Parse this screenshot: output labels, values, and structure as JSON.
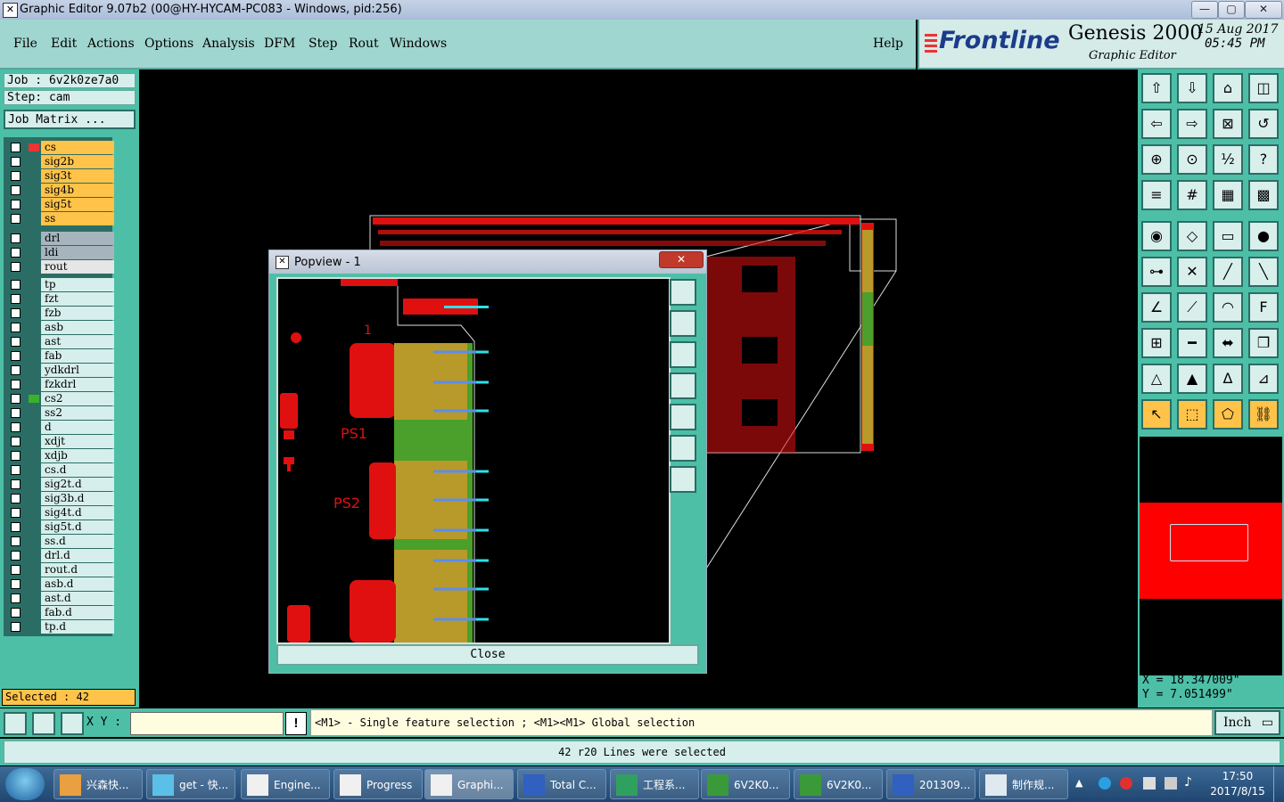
{
  "window": {
    "title": "Graphic Editor 9.07b2 (00@HY-HYCAM-PC083 - Windows, pid:256)",
    "min": "—",
    "max": "▢",
    "close": "✕"
  },
  "menu": {
    "items": [
      "File",
      "Edit",
      "Actions",
      "Options",
      "Analysis",
      "DFM",
      "Step",
      "Rout",
      "Windows"
    ],
    "help": "Help"
  },
  "brand": {
    "logo": "Frontline",
    "product": "Genesis 2000",
    "subtitle": "Graphic Editor",
    "date": "15 Aug 2017",
    "time": "05:45 PM"
  },
  "job": {
    "job_line": "Job : 6v2k0ze7a0",
    "step_line": "Step: cam",
    "matrix": "Job Matrix ..."
  },
  "layers": {
    "group1": [
      {
        "name": "cs",
        "color": "#ffc34a"
      },
      {
        "name": "sig2b",
        "color": "#ffc34a"
      },
      {
        "name": "sig3t",
        "color": "#ffc34a"
      },
      {
        "name": "sig4b",
        "color": "#ffc34a"
      },
      {
        "name": "sig5t",
        "color": "#ffc34a"
      },
      {
        "name": "ss",
        "color": "#ffc34a"
      }
    ],
    "group2": [
      {
        "name": "drl",
        "color": "#a6b5bd"
      },
      {
        "name": "ldi",
        "color": "#a6b5bd"
      },
      {
        "name": "rout",
        "color": "#e6e6e6"
      }
    ],
    "group3": [
      {
        "name": "tp"
      },
      {
        "name": "fzt"
      },
      {
        "name": "fzb"
      },
      {
        "name": "asb"
      },
      {
        "name": "ast"
      },
      {
        "name": "fab"
      },
      {
        "name": "ydkdrl"
      },
      {
        "name": "fzkdrl"
      },
      {
        "name": "cs2"
      },
      {
        "name": "ss2"
      },
      {
        "name": "d"
      },
      {
        "name": "xdjt"
      },
      {
        "name": "xdjb"
      },
      {
        "name": "cs.d"
      },
      {
        "name": "sig2t.d"
      },
      {
        "name": "sig3b.d"
      },
      {
        "name": "sig4t.d"
      },
      {
        "name": "sig5t.d"
      },
      {
        "name": "ss.d"
      },
      {
        "name": "drl.d"
      },
      {
        "name": "rout.d"
      },
      {
        "name": "asb.d"
      },
      {
        "name": "ast.d"
      },
      {
        "name": "fab.d"
      },
      {
        "name": "tp.d"
      }
    ]
  },
  "selected": "Selected : 42",
  "popview": {
    "title": "Popview - 1",
    "close": "Close",
    "label_1": "1",
    "label_ps1": "PS1",
    "label_ps2": "PS2"
  },
  "coords": {
    "x": "X  =  18.347009\"",
    "y": "Y  =  7.051499\""
  },
  "cmd": {
    "xy_label": "X Y :",
    "xy_value": "",
    "hint": "<M1> - Single feature selection ; <M1><M1> Global selection",
    "unit": "Inch"
  },
  "status": "42 r20 Lines were selected",
  "taskbar": {
    "items": [
      "兴森快...",
      "get - 快...",
      "Engine...",
      "Progress",
      "Graphi...",
      "Total C...",
      "工程系...",
      "6V2K0...",
      "6V2K0...",
      "201309...",
      "制作规..."
    ],
    "clock_time": "17:50",
    "clock_date": "2017/8/15"
  }
}
